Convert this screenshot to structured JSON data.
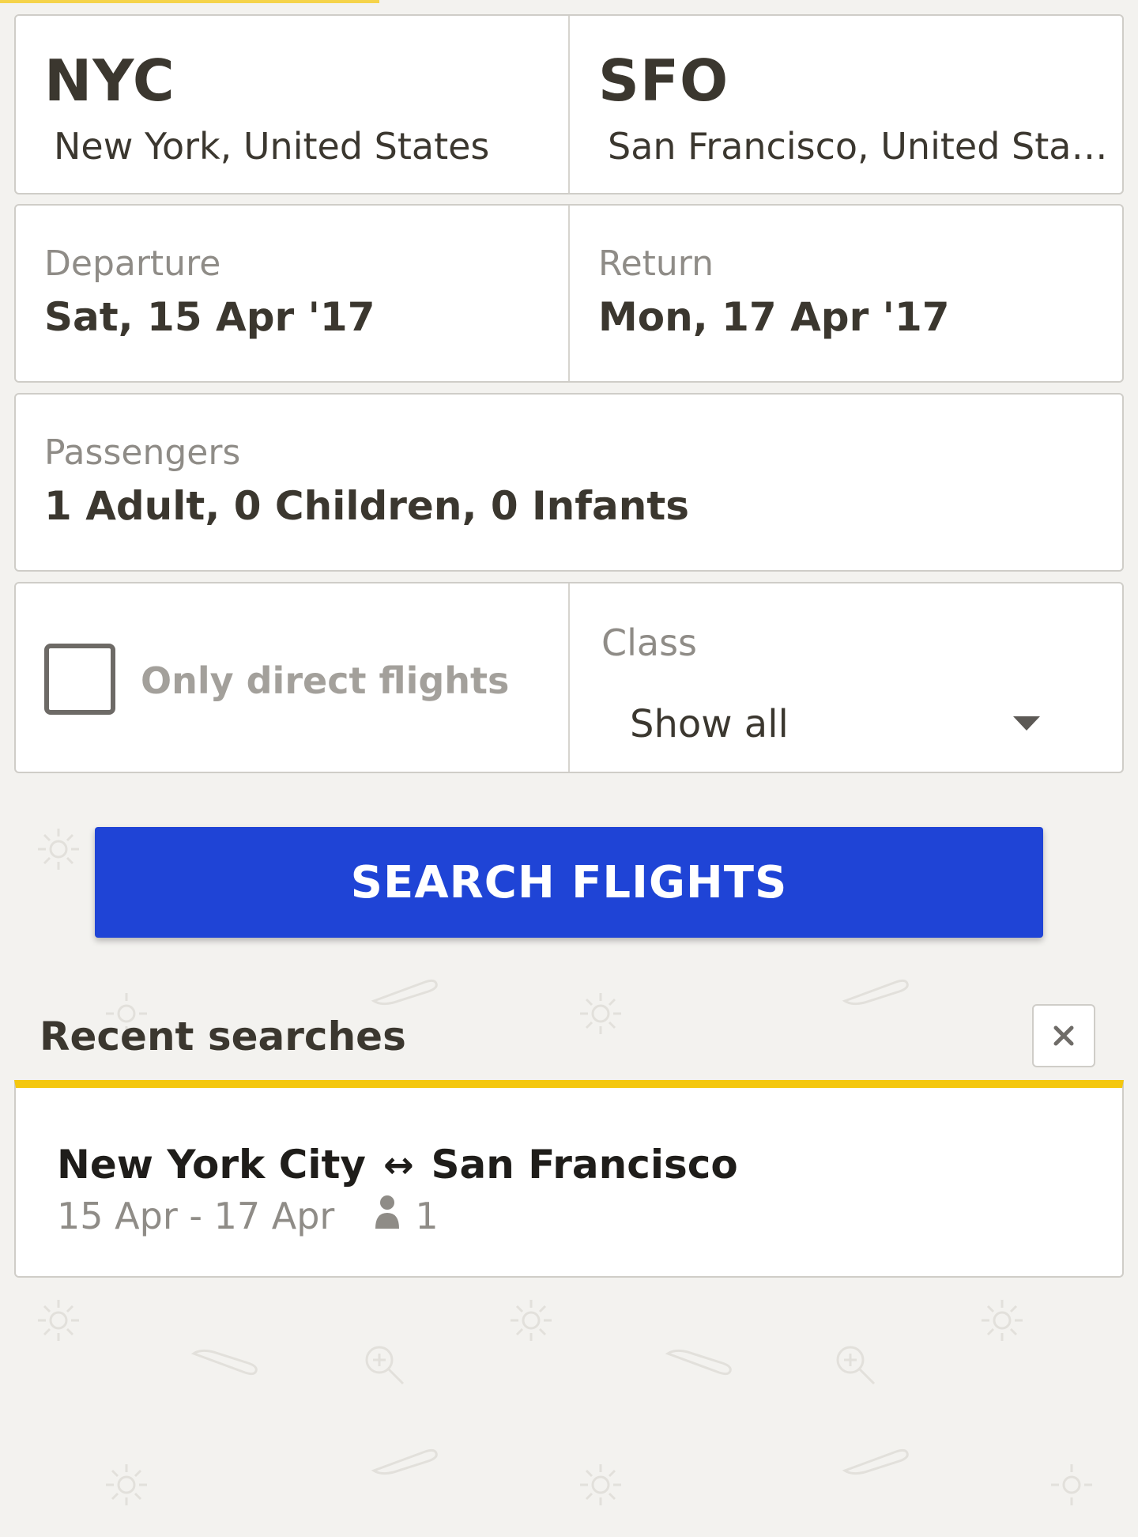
{
  "route": {
    "origin_code": "NYC",
    "origin_city": "New York, United States",
    "destination_code": "SFO",
    "destination_city": "San Francisco, United Stat..."
  },
  "dates": {
    "departure_label": "Departure",
    "departure_value": "Sat, 15 Apr '17",
    "return_label": "Return",
    "return_value": "Mon, 17 Apr '17"
  },
  "passengers": {
    "label": "Passengers",
    "value": "1 Adult, 0 Children, 0 Infants"
  },
  "options": {
    "direct_label": "Only direct flights",
    "direct_checked": false,
    "class_label": "Class",
    "class_value": "Show all"
  },
  "search_button": "SEARCH FLIGHTS",
  "recent": {
    "title": "Recent searches",
    "items": [
      {
        "from": "New York City",
        "arrow": "↔",
        "to": "San Francisco",
        "dates": "15 Apr - 17 Apr",
        "passengers": "1"
      }
    ]
  },
  "colors": {
    "background": "#f3f2ef",
    "primary_button": "#1f44d6",
    "accent_yellow": "#f4c70e",
    "text_dark": "#3b372f",
    "text_muted": "#8f8c87"
  },
  "icons": [
    "sun-icon",
    "plane-icon",
    "zoom-in-icon",
    "chevron-down-icon",
    "close-icon",
    "person-icon",
    "checkbox-icon"
  ]
}
